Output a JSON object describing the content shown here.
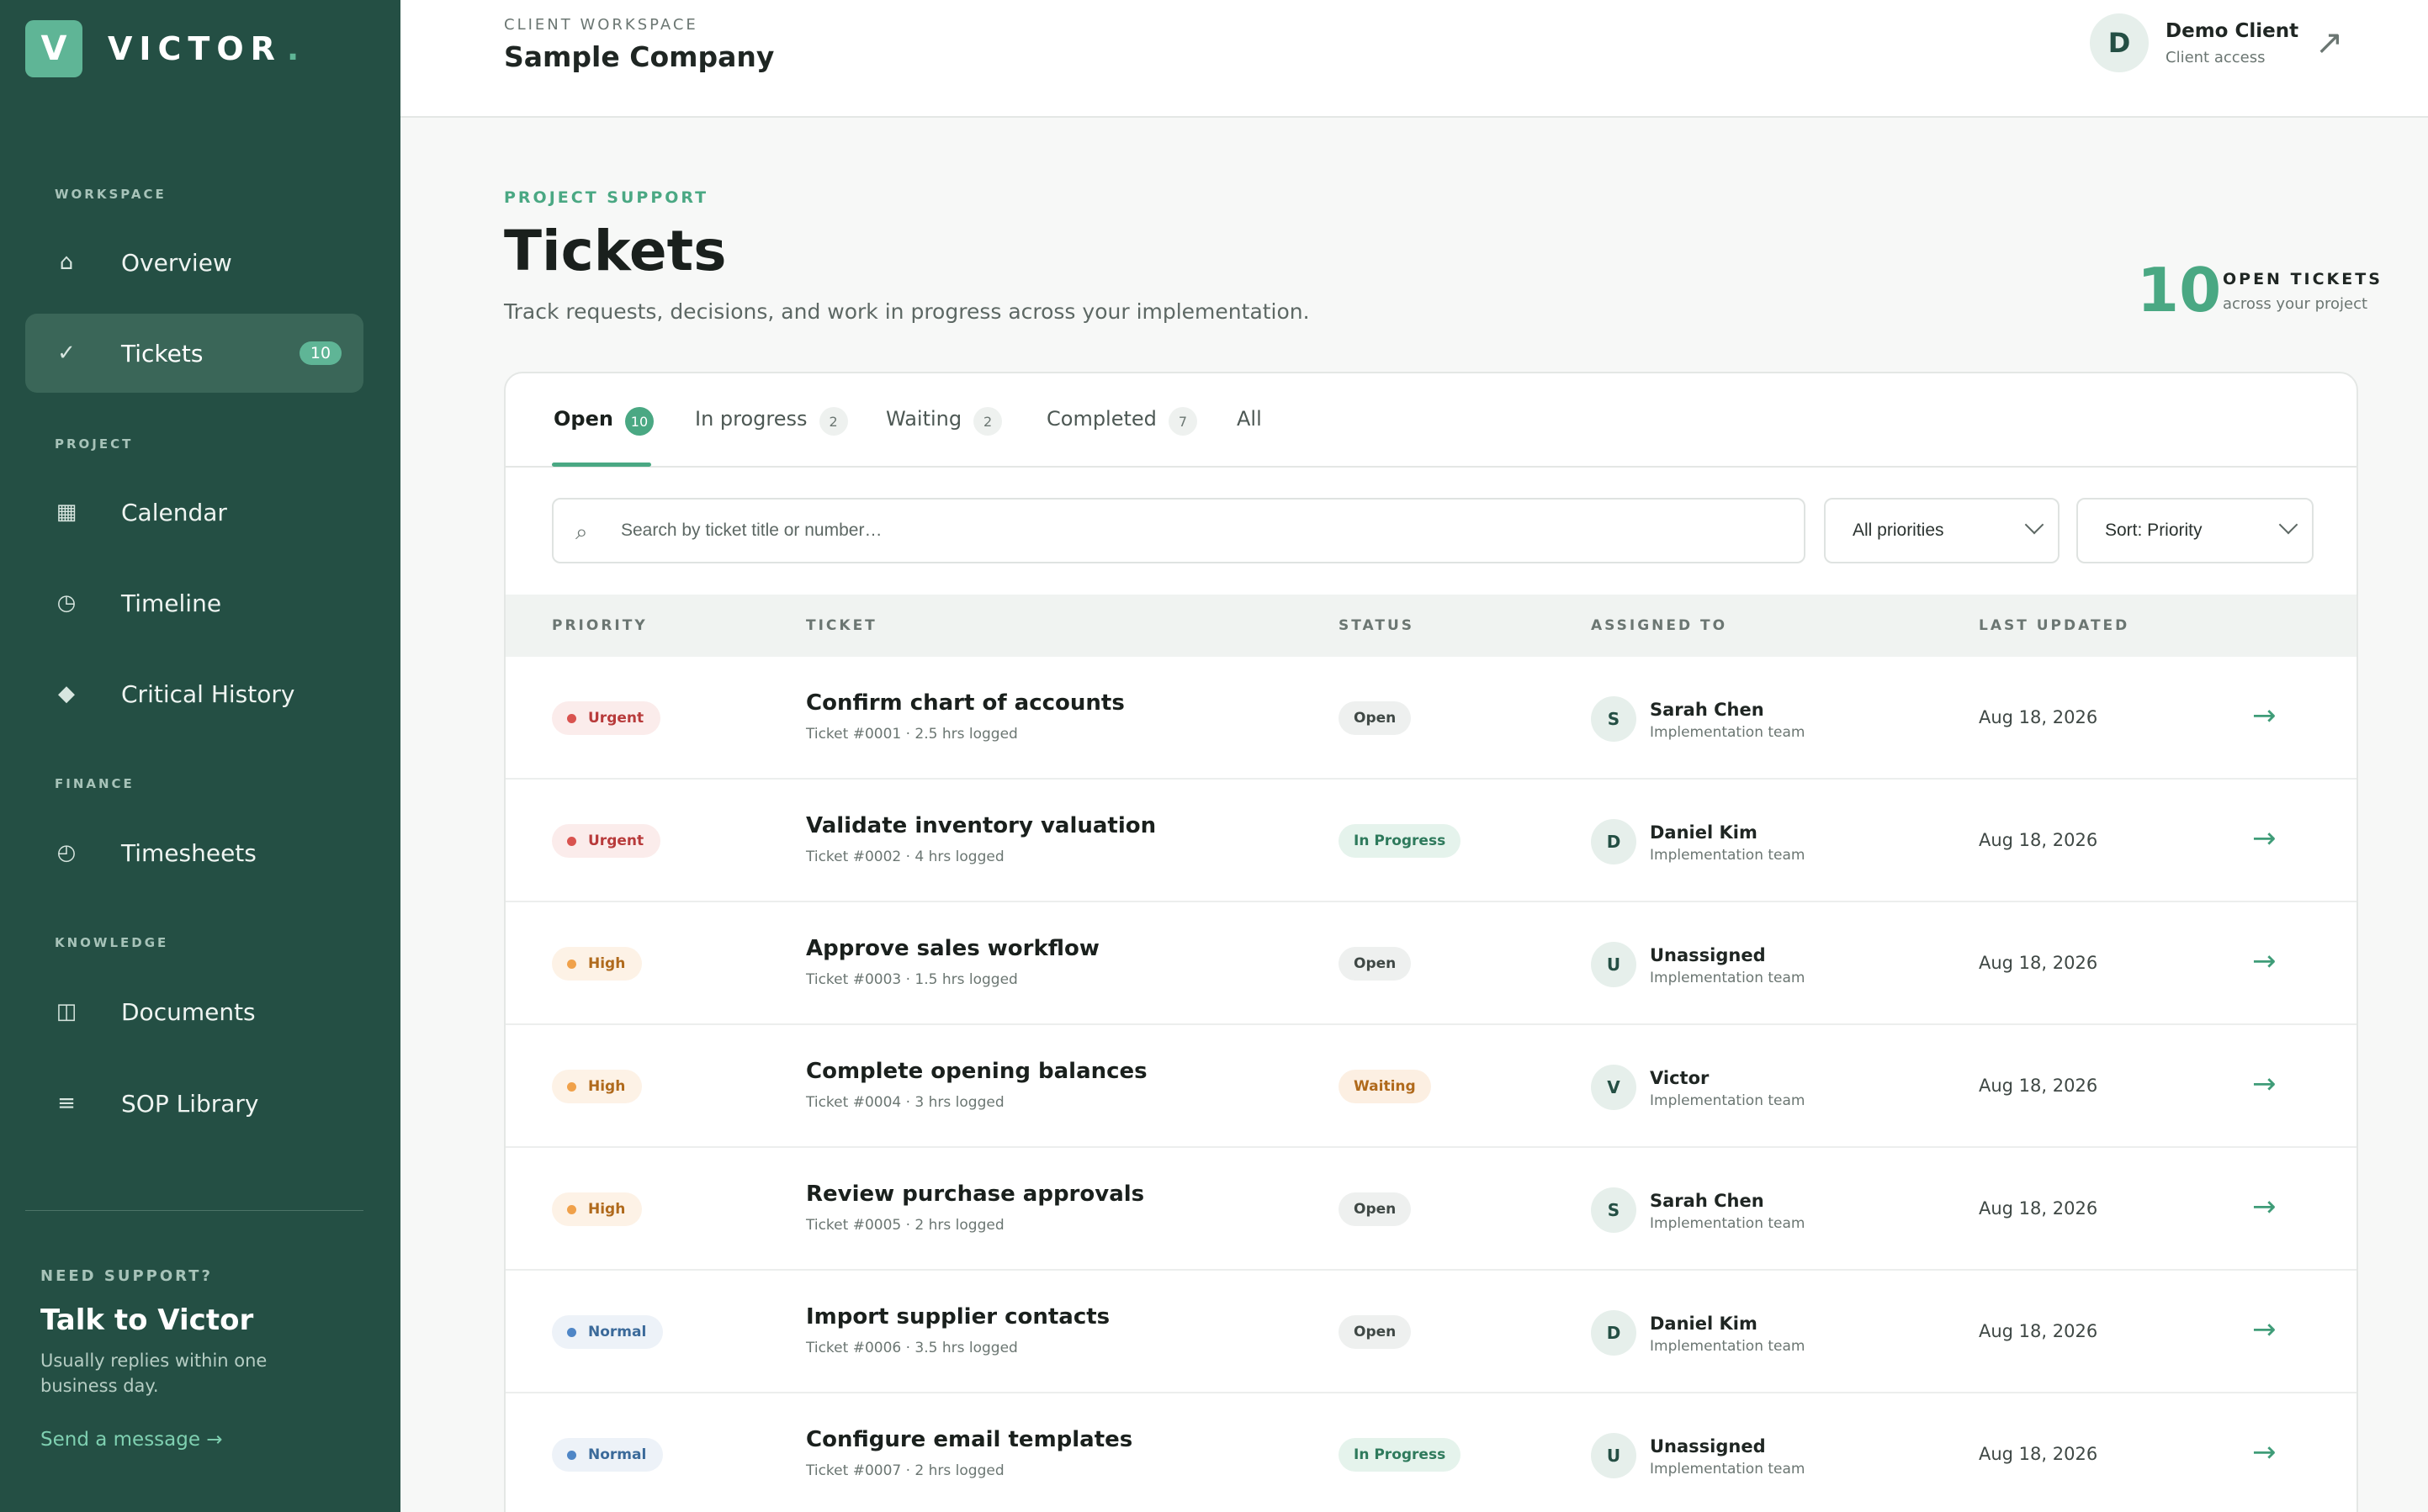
{
  "brand": {
    "initial": "V",
    "name": "VICTOR",
    "dot": ".",
    "accent": "#5fb596",
    "sidebar_bg": "#244f44"
  },
  "sidebar": {
    "sections": [
      "WORKSPACE",
      "PROJECT",
      "FINANCE",
      "KNOWLEDGE"
    ],
    "items": [
      {
        "label": "Overview",
        "icon": "home-icon",
        "glyph": "⌂"
      },
      {
        "label": "Tickets",
        "icon": "check-icon",
        "glyph": "✓",
        "badge": "10",
        "active": true
      },
      {
        "label": "Calendar",
        "icon": "calendar-icon",
        "glyph": "▦"
      },
      {
        "label": "Timeline",
        "icon": "clock-icon",
        "glyph": "◷"
      },
      {
        "label": "Critical History",
        "icon": "diamond-icon",
        "glyph": "◆"
      },
      {
        "label": "Timesheets",
        "icon": "stopwatch-icon",
        "glyph": "◴"
      },
      {
        "label": "Documents",
        "icon": "book-icon",
        "glyph": "◫"
      },
      {
        "label": "SOP Library",
        "icon": "list-icon",
        "glyph": "≡"
      }
    ],
    "support": {
      "label": "NEED SUPPORT?",
      "title": "Talk to Victor",
      "text": "Usually replies within one business day.",
      "link": "Send a message →"
    }
  },
  "topbar": {
    "workspace_label": "CLIENT WORKSPACE",
    "workspace_name": "Sample Company",
    "user": {
      "initial": "D",
      "name": "Demo Client",
      "role": "Client access"
    },
    "external_glyph": "↗"
  },
  "header": {
    "eyebrow": "PROJECT SUPPORT",
    "title": "Tickets",
    "subtitle": "Track requests, decisions, and work in progress across your implementation.",
    "stat": {
      "value": "10",
      "label": "OPEN TICKETS",
      "sub": "across your project"
    }
  },
  "tabs": [
    {
      "label": "Open",
      "count": "10",
      "active": true
    },
    {
      "label": "In progress",
      "count": "2"
    },
    {
      "label": "Waiting",
      "count": "2"
    },
    {
      "label": "Completed",
      "count": "7"
    },
    {
      "label": "All"
    }
  ],
  "filters": {
    "search_placeholder": "Search by ticket title or number…",
    "search_icon": "⌕",
    "priority": "All priorities",
    "sort": "Sort: Priority"
  },
  "table": {
    "headers": [
      "PRIORITY",
      "TICKET",
      "STATUS",
      "ASSIGNED TO",
      "LAST UPDATED"
    ],
    "rows": [
      {
        "priority": "Urgent",
        "pclass": "urgent",
        "title": "Confirm chart of accounts",
        "meta": "Ticket #0001 · 2.5 hrs logged",
        "status": "Open",
        "sclass": "open",
        "initial": "S",
        "assignee": "Sarah Chen",
        "team": "Implementation team",
        "updated": "Aug 18, 2026",
        "arrow": "→"
      },
      {
        "priority": "Urgent",
        "pclass": "urgent",
        "title": "Validate inventory valuation",
        "meta": "Ticket #0002 · 4 hrs logged",
        "status": "In Progress",
        "sclass": "progress",
        "initial": "D",
        "assignee": "Daniel Kim",
        "team": "Implementation team",
        "updated": "Aug 18, 2026",
        "arrow": "→"
      },
      {
        "priority": "High",
        "pclass": "high",
        "title": "Approve sales workflow",
        "meta": "Ticket #0003 · 1.5 hrs logged",
        "status": "Open",
        "sclass": "open",
        "initial": "U",
        "assignee": "Unassigned",
        "team": "Implementation team",
        "updated": "Aug 18, 2026",
        "arrow": "→"
      },
      {
        "priority": "High",
        "pclass": "high",
        "title": "Complete opening balances",
        "meta": "Ticket #0004 · 3 hrs logged",
        "status": "Waiting",
        "sclass": "waiting",
        "initial": "V",
        "assignee": "Victor",
        "team": "Implementation team",
        "updated": "Aug 18, 2026",
        "arrow": "→"
      },
      {
        "priority": "High",
        "pclass": "high",
        "title": "Review purchase approvals",
        "meta": "Ticket #0005 · 2 hrs logged",
        "status": "Open",
        "sclass": "open",
        "initial": "S",
        "assignee": "Sarah Chen",
        "team": "Implementation team",
        "updated": "Aug 18, 2026",
        "arrow": "→"
      },
      {
        "priority": "Normal",
        "pclass": "normal",
        "title": "Import supplier contacts",
        "meta": "Ticket #0006 · 3.5 hrs logged",
        "status": "Open",
        "sclass": "open",
        "initial": "D",
        "assignee": "Daniel Kim",
        "team": "Implementation team",
        "updated": "Aug 18, 2026",
        "arrow": "→"
      },
      {
        "priority": "Normal",
        "pclass": "normal",
        "title": "Configure email templates",
        "meta": "Ticket #0007 · 2 hrs logged",
        "status": "In Progress",
        "sclass": "progress",
        "initial": "U",
        "assignee": "Unassigned",
        "team": "Implementation team",
        "updated": "Aug 18, 2026",
        "arrow": "→"
      }
    ]
  }
}
